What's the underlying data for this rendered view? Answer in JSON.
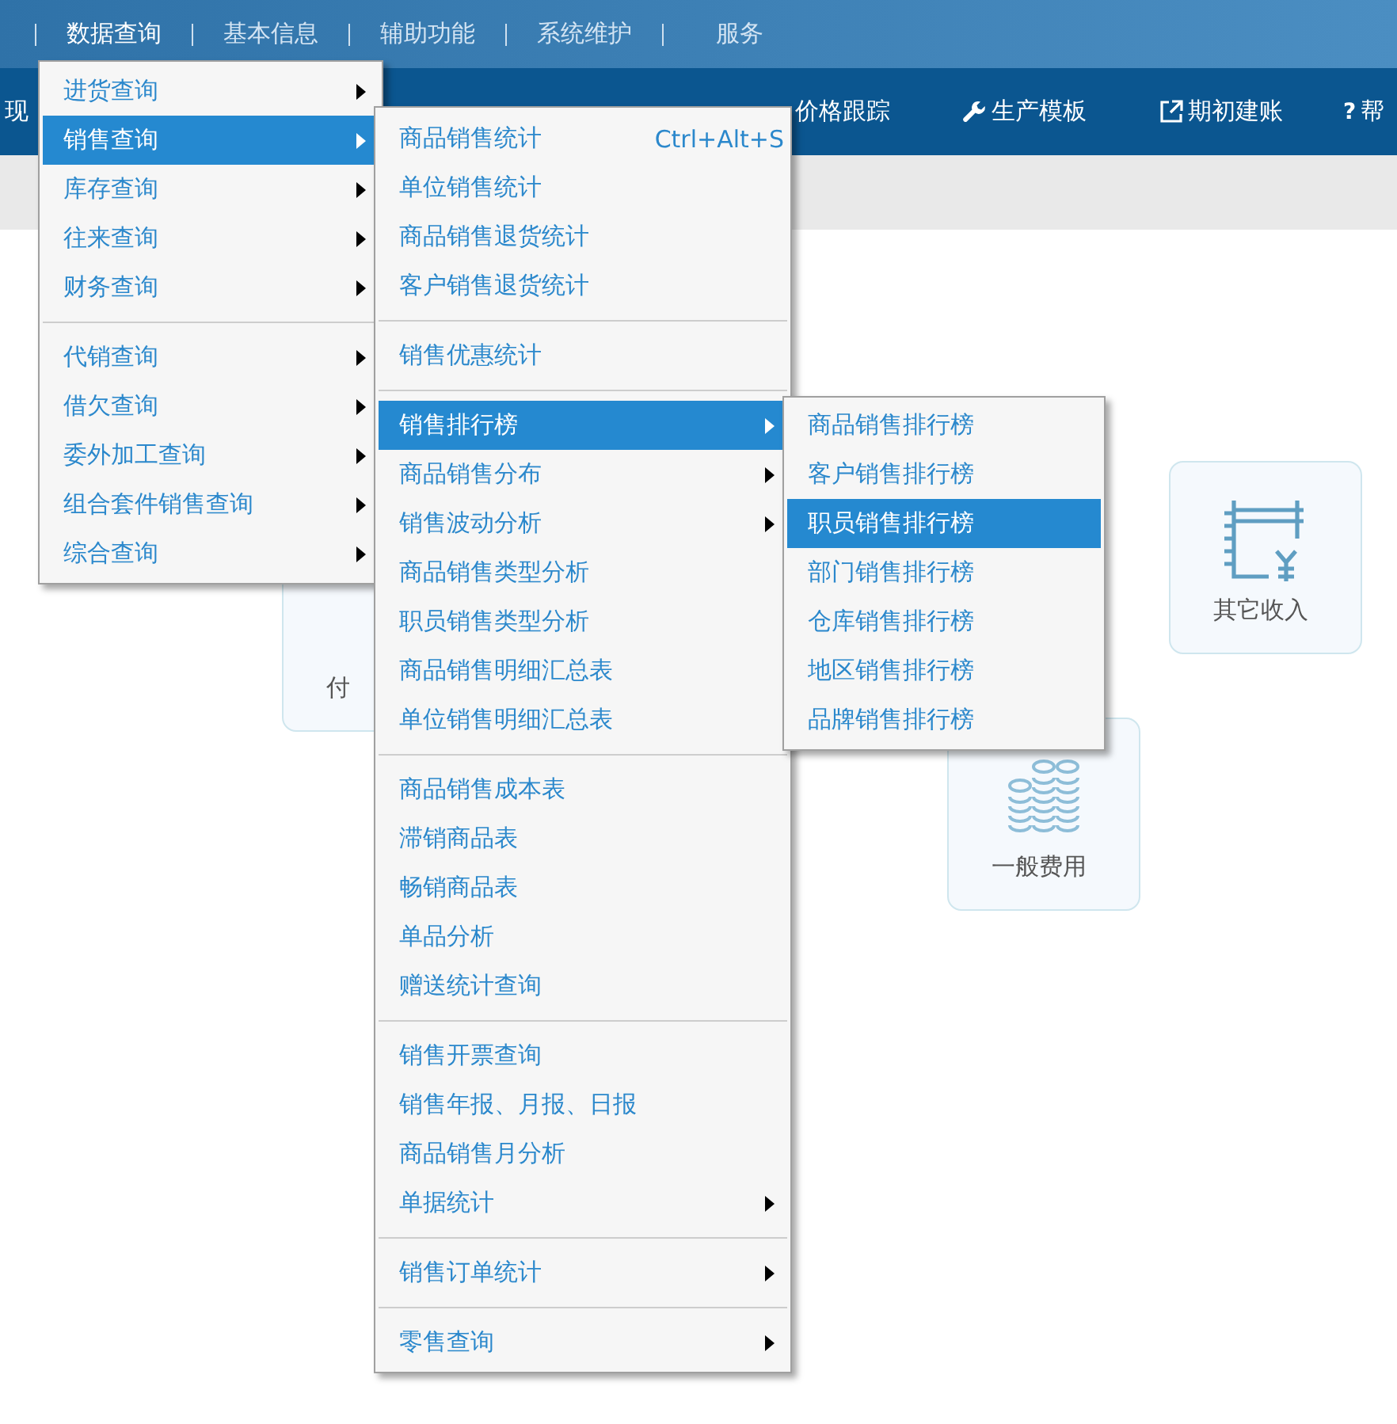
{
  "nav": {
    "items": [
      {
        "label": "数据查询",
        "selected": true
      },
      {
        "label": "基本信息",
        "selected": false
      },
      {
        "label": "辅助功能",
        "selected": false
      },
      {
        "label": "系统维护",
        "selected": false
      },
      {
        "label": "服务",
        "selected": false
      }
    ]
  },
  "toolbar": {
    "items": [
      {
        "kind": "plain",
        "label": "现"
      },
      {
        "kind": "plain",
        "label": "价格跟踪"
      },
      {
        "kind": "wrench",
        "label": "生产模板"
      },
      {
        "kind": "export",
        "label": "期初建账"
      },
      {
        "kind": "help",
        "glyph": "?",
        "label": "帮"
      }
    ]
  },
  "cards": [
    {
      "kind": "hidden-icon",
      "label": "付"
    },
    {
      "kind": "ledger",
      "label": "其它收入"
    },
    {
      "kind": "coins",
      "label": "一般费用"
    }
  ],
  "menus": [
    {
      "sections": [
        [
          {
            "label": "进货查询",
            "selected": false,
            "submenu": true
          },
          {
            "label": "销售查询",
            "selected": true,
            "submenu": true
          },
          {
            "label": "库存查询",
            "selected": false,
            "submenu": true
          },
          {
            "label": "往来查询",
            "selected": false,
            "submenu": true
          },
          {
            "label": "财务查询",
            "selected": false,
            "submenu": true
          }
        ],
        [
          {
            "label": "代销查询",
            "selected": false,
            "submenu": true
          },
          {
            "label": "借欠查询",
            "selected": false,
            "submenu": true
          },
          {
            "label": "委外加工查询",
            "selected": false,
            "submenu": true
          },
          {
            "label": "组合套件销售查询",
            "selected": false,
            "submenu": true
          },
          {
            "label": "综合查询",
            "selected": false,
            "submenu": true
          }
        ]
      ]
    },
    {
      "sections": [
        [
          {
            "label": "商品销售统计",
            "selected": false,
            "submenu": false,
            "shortcut": "Ctrl+Alt+S"
          },
          {
            "label": "单位销售统计",
            "selected": false,
            "submenu": false
          },
          {
            "label": "商品销售退货统计",
            "selected": false,
            "submenu": false
          },
          {
            "label": "客户销售退货统计",
            "selected": false,
            "submenu": false
          }
        ],
        [
          {
            "label": "销售优惠统计",
            "selected": false,
            "submenu": false
          }
        ],
        [
          {
            "label": "销售排行榜",
            "selected": true,
            "submenu": true
          },
          {
            "label": "商品销售分布",
            "selected": false,
            "submenu": true
          },
          {
            "label": "销售波动分析",
            "selected": false,
            "submenu": true
          },
          {
            "label": "商品销售类型分析",
            "selected": false,
            "submenu": false
          },
          {
            "label": "职员销售类型分析",
            "selected": false,
            "submenu": false
          },
          {
            "label": "商品销售明细汇总表",
            "selected": false,
            "submenu": false
          },
          {
            "label": "单位销售明细汇总表",
            "selected": false,
            "submenu": false
          }
        ],
        [
          {
            "label": "商品销售成本表",
            "selected": false,
            "submenu": false
          },
          {
            "label": "滞销商品表",
            "selected": false,
            "submenu": false
          },
          {
            "label": "畅销商品表",
            "selected": false,
            "submenu": false
          },
          {
            "label": "单品分析",
            "selected": false,
            "submenu": false
          },
          {
            "label": "赠送统计查询",
            "selected": false,
            "submenu": false
          }
        ],
        [
          {
            "label": "销售开票查询",
            "selected": false,
            "submenu": false
          },
          {
            "label": "销售年报、月报、日报",
            "selected": false,
            "submenu": false
          },
          {
            "label": "商品销售月分析",
            "selected": false,
            "submenu": false
          },
          {
            "label": "单据统计",
            "selected": false,
            "submenu": true
          }
        ],
        [
          {
            "label": "销售订单统计",
            "selected": false,
            "submenu": true
          }
        ],
        [
          {
            "label": "零售查询",
            "selected": false,
            "submenu": true
          }
        ]
      ]
    },
    {
      "sections": [
        [
          {
            "label": "商品销售排行榜",
            "selected": false,
            "submenu": false
          },
          {
            "label": "客户销售排行榜",
            "selected": false,
            "submenu": false
          },
          {
            "label": "职员销售排行榜",
            "selected": true,
            "submenu": false
          },
          {
            "label": "部门销售排行榜",
            "selected": false,
            "submenu": false
          },
          {
            "label": "仓库销售排行榜",
            "selected": false,
            "submenu": false
          },
          {
            "label": "地区销售排行榜",
            "selected": false,
            "submenu": false
          },
          {
            "label": "品牌销售排行榜",
            "selected": false,
            "submenu": false
          }
        ]
      ]
    }
  ]
}
